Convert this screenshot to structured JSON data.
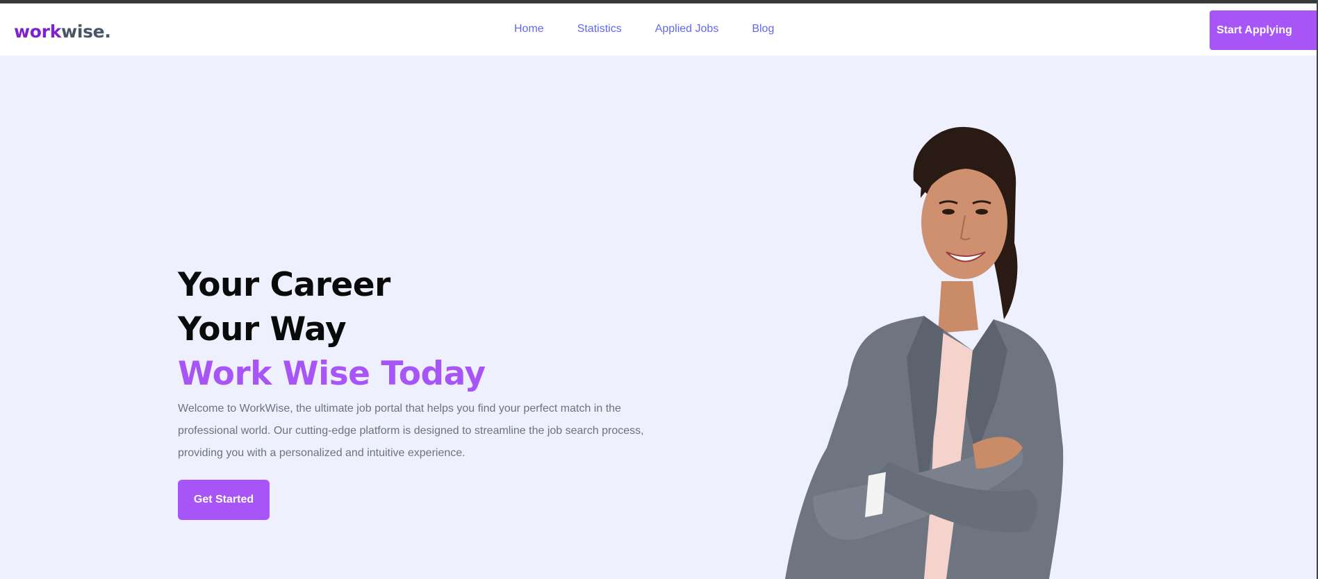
{
  "brand": {
    "logo_part1": "work",
    "logo_part2": "wise.",
    "accent_color": "#a855f7",
    "logo_color_1": "#7e22ce",
    "logo_color_2": "#475569"
  },
  "nav": {
    "items": [
      {
        "label": "Home"
      },
      {
        "label": "Statistics"
      },
      {
        "label": "Applied Jobs"
      },
      {
        "label": "Blog"
      }
    ],
    "link_color": "#6366f1",
    "cta_label": "Start Applying"
  },
  "hero": {
    "title_line1": "Your Career",
    "title_line2": "Your Way",
    "title_line3": "Work Wise Today",
    "description": "Welcome to WorkWise, the ultimate job portal that helps you find your perfect match in the professional world. Our cutting-edge platform is designed to streamline the job search process, providing you with a personalized and intuitive experience.",
    "cta_label": "Get Started",
    "background_color": "#eef0fd",
    "image": "smiling-businesswoman-portrait"
  }
}
